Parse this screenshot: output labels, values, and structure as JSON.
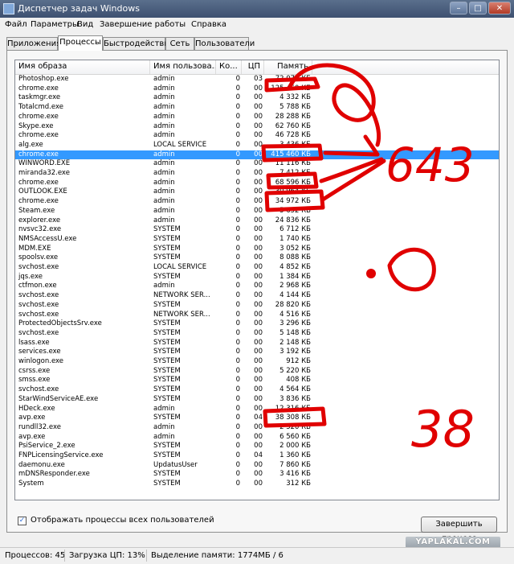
{
  "window": {
    "title": "Диспетчер задач Windows",
    "min_label": "–",
    "max_label": "□",
    "close_label": "✕"
  },
  "menu": [
    "Файл",
    "Параметры",
    "Вид",
    "Завершение работы",
    "Справка"
  ],
  "tabs": [
    "Приложения",
    "Процессы",
    "Быстродействие",
    "Сеть",
    "Пользователи"
  ],
  "columns": {
    "name": "Имя образа",
    "user": "Имя пользова...",
    "cpu": "Ко...",
    "cp": "ЦП",
    "mem": "Память"
  },
  "processes": [
    {
      "name": "Photoshop.exe",
      "user": "admin",
      "cpu": "0",
      "cp": "03",
      "mem": "72 072 КБ"
    },
    {
      "name": "chrome.exe",
      "user": "admin",
      "cpu": "0",
      "cp": "00",
      "mem": "125 460 КБ"
    },
    {
      "name": "taskmgr.exe",
      "user": "admin",
      "cpu": "0",
      "cp": "00",
      "mem": "4 332 КБ"
    },
    {
      "name": "Totalcmd.exe",
      "user": "admin",
      "cpu": "0",
      "cp": "00",
      "mem": "5 788 КБ"
    },
    {
      "name": "chrome.exe",
      "user": "admin",
      "cpu": "0",
      "cp": "00",
      "mem": "28 288 КБ"
    },
    {
      "name": "Skype.exe",
      "user": "admin",
      "cpu": "0",
      "cp": "00",
      "mem": "62 760 КБ"
    },
    {
      "name": "chrome.exe",
      "user": "admin",
      "cpu": "0",
      "cp": "00",
      "mem": "46 728 КБ"
    },
    {
      "name": "alg.exe",
      "user": "LOCAL SERVICE",
      "cpu": "0",
      "cp": "00",
      "mem": "3 436 КБ"
    },
    {
      "name": "chrome.exe",
      "user": "admin",
      "cpu": "0",
      "cp": "00",
      "mem": "415 460 КБ",
      "selected": true
    },
    {
      "name": "WINWORD.EXE",
      "user": "admin",
      "cpu": "0",
      "cp": "00",
      "mem": "11 116 КБ"
    },
    {
      "name": "miranda32.exe",
      "user": "admin",
      "cpu": "0",
      "cp": "00",
      "mem": "7 412 КБ"
    },
    {
      "name": "chrome.exe",
      "user": "admin",
      "cpu": "0",
      "cp": "00",
      "mem": "68 596 КБ"
    },
    {
      "name": "OUTLOOK.EXE",
      "user": "admin",
      "cpu": "0",
      "cp": "00",
      "mem": "30 964 КБ"
    },
    {
      "name": "chrome.exe",
      "user": "admin",
      "cpu": "0",
      "cp": "00",
      "mem": "34 972 КБ"
    },
    {
      "name": "Steam.exe",
      "user": "admin",
      "cpu": "0",
      "cp": "00",
      "mem": "5 652 КБ"
    },
    {
      "name": "explorer.exe",
      "user": "admin",
      "cpu": "0",
      "cp": "00",
      "mem": "24 836 КБ"
    },
    {
      "name": "nvsvc32.exe",
      "user": "SYSTEM",
      "cpu": "0",
      "cp": "00",
      "mem": "6 712 КБ"
    },
    {
      "name": "NMSAccessU.exe",
      "user": "SYSTEM",
      "cpu": "0",
      "cp": "00",
      "mem": "1 740 КБ"
    },
    {
      "name": "MDM.EXE",
      "user": "SYSTEM",
      "cpu": "0",
      "cp": "00",
      "mem": "3 052 КБ"
    },
    {
      "name": "spoolsv.exe",
      "user": "SYSTEM",
      "cpu": "0",
      "cp": "00",
      "mem": "8 088 КБ"
    },
    {
      "name": "svchost.exe",
      "user": "LOCAL SERVICE",
      "cpu": "0",
      "cp": "00",
      "mem": "4 852 КБ"
    },
    {
      "name": "jqs.exe",
      "user": "SYSTEM",
      "cpu": "0",
      "cp": "00",
      "mem": "1 384 КБ"
    },
    {
      "name": "ctfmon.exe",
      "user": "admin",
      "cpu": "0",
      "cp": "00",
      "mem": "2 968 КБ"
    },
    {
      "name": "svchost.exe",
      "user": "NETWORK SER...",
      "cpu": "0",
      "cp": "00",
      "mem": "4 144 КБ"
    },
    {
      "name": "svchost.exe",
      "user": "SYSTEM",
      "cpu": "0",
      "cp": "00",
      "mem": "28 820 КБ"
    },
    {
      "name": "svchost.exe",
      "user": "NETWORK SER...",
      "cpu": "0",
      "cp": "00",
      "mem": "4 516 КБ"
    },
    {
      "name": "ProtectedObjectsSrv.exe",
      "user": "SYSTEM",
      "cpu": "0",
      "cp": "00",
      "mem": "3 296 КБ"
    },
    {
      "name": "svchost.exe",
      "user": "SYSTEM",
      "cpu": "0",
      "cp": "00",
      "mem": "5 148 КБ"
    },
    {
      "name": "lsass.exe",
      "user": "SYSTEM",
      "cpu": "0",
      "cp": "00",
      "mem": "2 148 КБ"
    },
    {
      "name": "services.exe",
      "user": "SYSTEM",
      "cpu": "0",
      "cp": "00",
      "mem": "3 192 КБ"
    },
    {
      "name": "winlogon.exe",
      "user": "SYSTEM",
      "cpu": "0",
      "cp": "00",
      "mem": "912 КБ"
    },
    {
      "name": "csrss.exe",
      "user": "SYSTEM",
      "cpu": "0",
      "cp": "00",
      "mem": "5 220 КБ"
    },
    {
      "name": "smss.exe",
      "user": "SYSTEM",
      "cpu": "0",
      "cp": "00",
      "mem": "408 КБ"
    },
    {
      "name": "svchost.exe",
      "user": "SYSTEM",
      "cpu": "0",
      "cp": "00",
      "mem": "4 564 КБ"
    },
    {
      "name": "StarWindServiceAE.exe",
      "user": "SYSTEM",
      "cpu": "0",
      "cp": "00",
      "mem": "3 836 КБ"
    },
    {
      "name": "HDeck.exe",
      "user": "admin",
      "cpu": "0",
      "cp": "00",
      "mem": "12 316 КБ"
    },
    {
      "name": "avp.exe",
      "user": "SYSTEM",
      "cpu": "0",
      "cp": "04",
      "mem": "38 308 КБ"
    },
    {
      "name": "rundll32.exe",
      "user": "admin",
      "cpu": "0",
      "cp": "00",
      "mem": "2 520 КБ"
    },
    {
      "name": "avp.exe",
      "user": "admin",
      "cpu": "0",
      "cp": "00",
      "mem": "6 560 КБ"
    },
    {
      "name": "PsiService_2.exe",
      "user": "SYSTEM",
      "cpu": "0",
      "cp": "00",
      "mem": "2 000 КБ"
    },
    {
      "name": "FNPLicensingService.exe",
      "user": "SYSTEM",
      "cpu": "0",
      "cp": "04",
      "mem": "1 360 КБ"
    },
    {
      "name": "daemonu.exe",
      "user": "UpdatusUser",
      "cpu": "0",
      "cp": "00",
      "mem": "7 860 КБ"
    },
    {
      "name": "mDNSResponder.exe",
      "user": "SYSTEM",
      "cpu": "0",
      "cp": "00",
      "mem": "3 416 КБ"
    },
    {
      "name": "System",
      "user": "SYSTEM",
      "cpu": "0",
      "cp": "00",
      "mem": "312 КБ"
    }
  ],
  "checkbox_label": "Отображать процессы всех пользователей",
  "end_button": "Завершить процесс",
  "watermark": "YAPLAKAL.COM",
  "status": {
    "processes": "Процессов: 45",
    "cpu": "Загрузка ЦП: 13%",
    "memory": "Выделение памяти: 1774МБ / 6"
  },
  "annotations": {
    "number_1": "643",
    "number_2": "38",
    "face": ":D"
  },
  "colors": {
    "ink": "#e00000",
    "selection": "#3399ff",
    "title": "#4a5f80"
  }
}
